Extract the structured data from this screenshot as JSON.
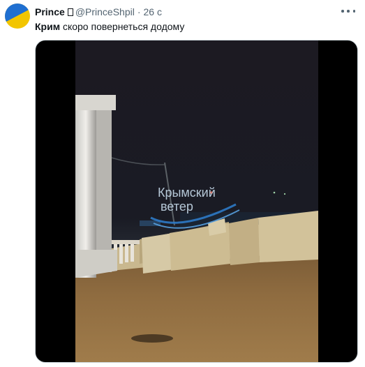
{
  "tweet": {
    "author_name": "Prince",
    "handle": "@PrinceShpil",
    "separator": "·",
    "timestamp": "26 с",
    "text_bold": "Крим",
    "text_rest": " скоро повернеться додому"
  },
  "media": {
    "type": "video",
    "watermark_line1": "Крымский",
    "watermark_line2": "ветер"
  },
  "icons": {
    "avatar": "ukraine-flag-avatar",
    "more": "more-horizontal-icon"
  },
  "colors": {
    "flag_blue": "#1f6fd1",
    "flag_yellow": "#f2c500",
    "secondary_text": "#536471"
  }
}
